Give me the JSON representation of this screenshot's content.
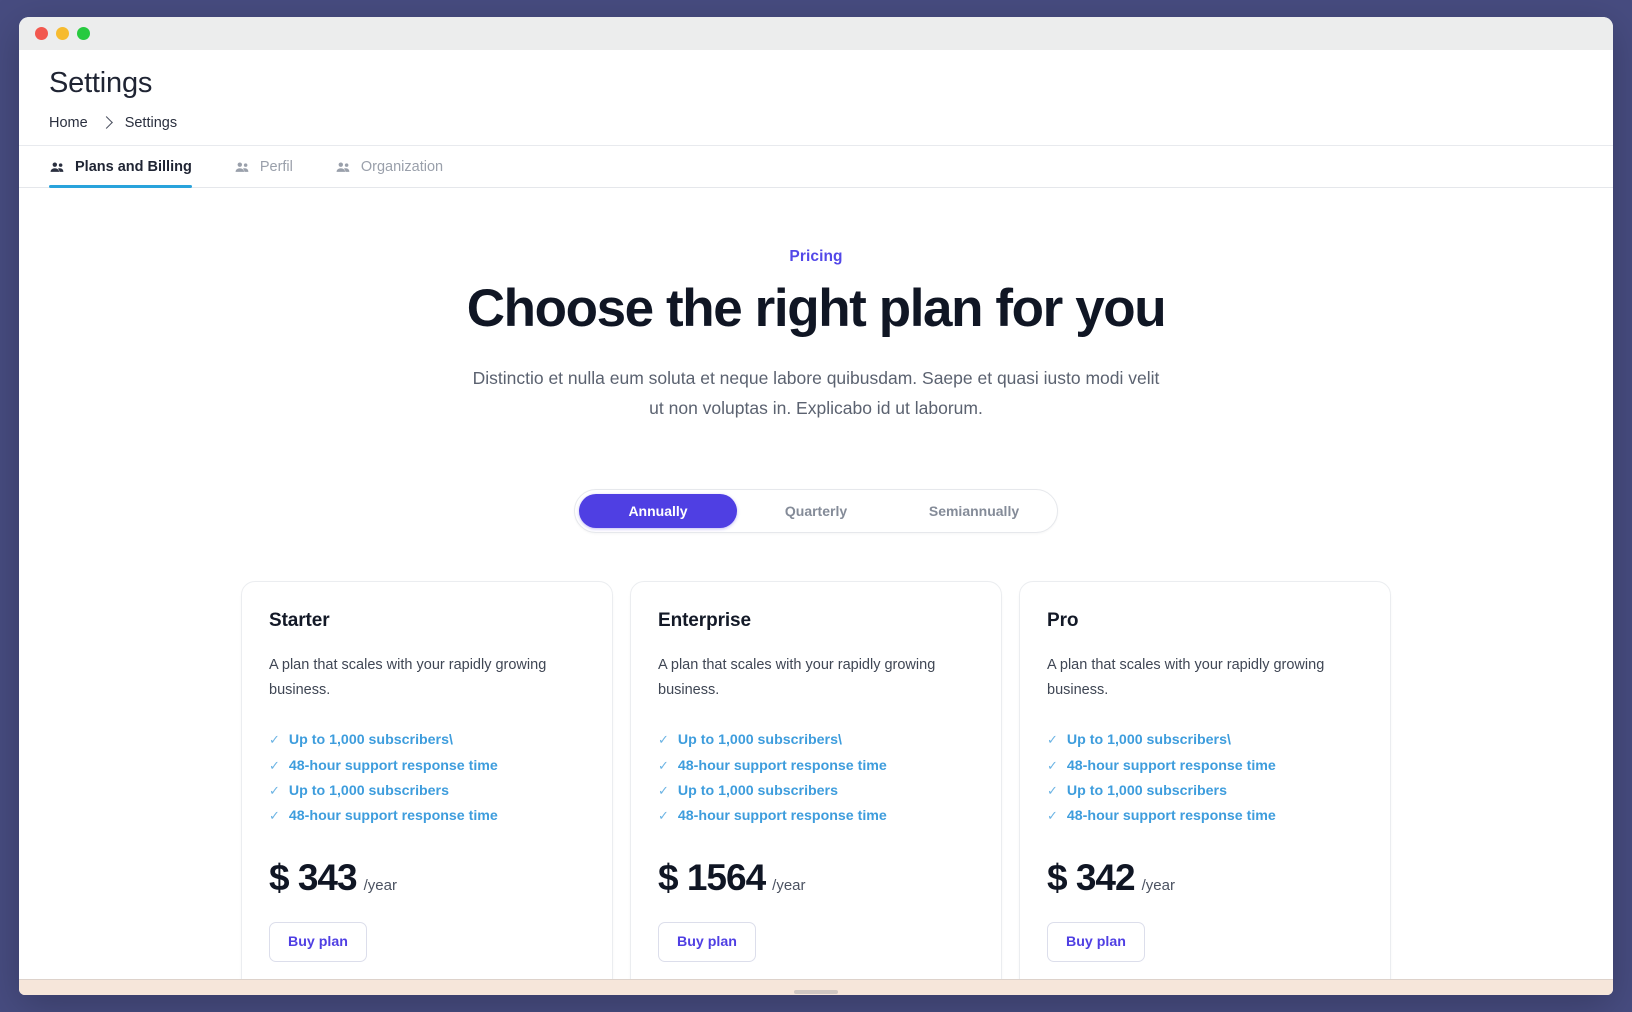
{
  "window": {
    "traffic_lights": [
      "close",
      "minimize",
      "zoom"
    ],
    "colors": {
      "desktop": "#474c80",
      "accent_indigo": "#4f3fe3",
      "eyebrow": "#5348e8",
      "tab_underline": "#29a3dc",
      "feature_blue": "#3e9ddd",
      "statusbar": "#f6e6da"
    }
  },
  "header": {
    "title": "Settings",
    "breadcrumb": [
      {
        "label": "Home"
      },
      {
        "label": "Settings"
      }
    ]
  },
  "tabs": [
    {
      "label": "Plans and Billing",
      "icon": "users-icon",
      "active": true
    },
    {
      "label": "Perfil",
      "icon": "users-icon",
      "active": false
    },
    {
      "label": "Organization",
      "icon": "users-icon",
      "active": false
    }
  ],
  "pricing": {
    "eyebrow": "Pricing",
    "headline": "Choose the right plan for you",
    "subhead": "Distinctio et nulla eum soluta et neque labore quibusdam. Saepe et quasi iusto modi velit ut non voluptas in. Explicabo id ut laborum."
  },
  "billing_switch": {
    "options": [
      {
        "label": "Annually",
        "active": true
      },
      {
        "label": "Quarterly",
        "active": false
      },
      {
        "label": "Semiannually",
        "active": false
      }
    ]
  },
  "plans": [
    {
      "name": "Starter",
      "description": "A plan that scales with your rapidly growing business.",
      "features": [
        "Up to 1,000 subscribers\\",
        "48-hour support response time",
        "Up to 1,000 subscribers",
        "48-hour support response time"
      ],
      "currency": "$",
      "amount": "343",
      "price": "$ 343",
      "period": "/year",
      "cta": "Buy plan"
    },
    {
      "name": "Enterprise",
      "description": "A plan that scales with your rapidly growing business.",
      "features": [
        "Up to 1,000 subscribers\\",
        "48-hour support response time",
        "Up to 1,000 subscribers",
        "48-hour support response time"
      ],
      "currency": "$",
      "amount": "1564",
      "price": "$ 1564",
      "period": "/year",
      "cta": "Buy plan"
    },
    {
      "name": "Pro",
      "description": "A plan that scales with your rapidly growing business.",
      "features": [
        "Up to 1,000 subscribers\\",
        "48-hour support response time",
        "Up to 1,000 subscribers",
        "48-hour support response time"
      ],
      "currency": "$",
      "amount": "342",
      "price": "$ 342",
      "period": "/year",
      "cta": "Buy plan"
    }
  ],
  "icons": {
    "check": "✓",
    "breadcrumb_separator": "chevron-right-icon"
  }
}
